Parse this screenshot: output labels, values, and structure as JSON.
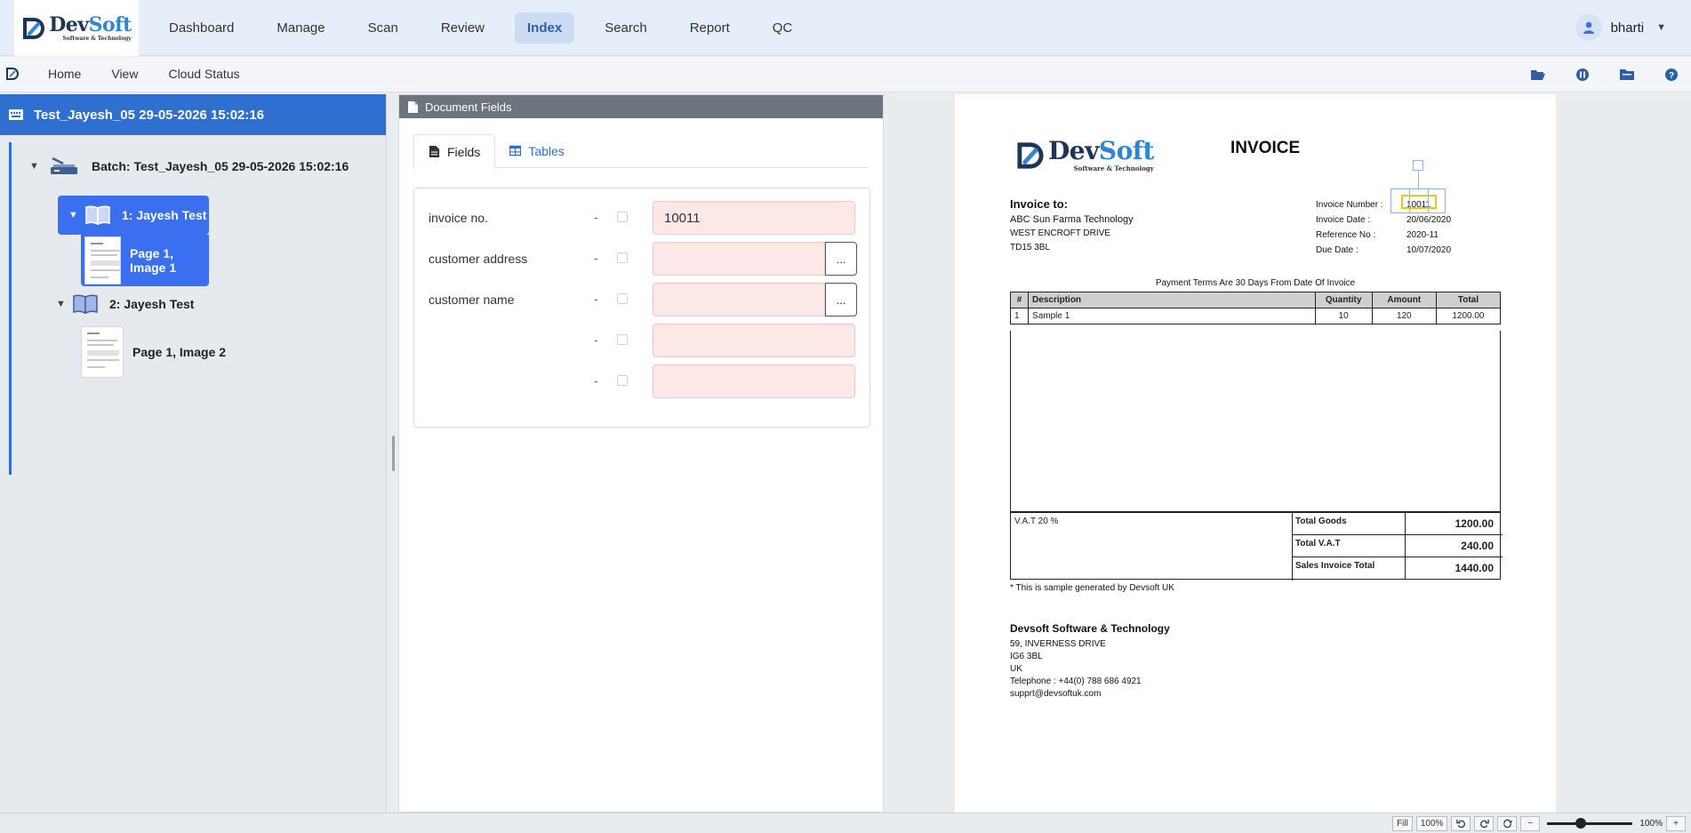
{
  "app": {
    "logo_word_1": "Dev",
    "logo_word_2": "Soft",
    "logo_tagline": "Software & Technology",
    "brand_color": "#2f6fcf"
  },
  "nav": {
    "items": [
      "Dashboard",
      "Manage",
      "Scan",
      "Review",
      "Index",
      "Search",
      "Report",
      "QC"
    ],
    "active": "Index"
  },
  "user": {
    "name": "bharti"
  },
  "subnav": {
    "items": [
      "Home",
      "View",
      "Cloud Status"
    ],
    "tools": [
      "folder-open-icon",
      "pause-circle-icon",
      "folder-icon",
      "help-icon"
    ]
  },
  "tree": {
    "root": "Test_Jayesh_05 29-05-2026 15:02:16",
    "batch": "Batch: Test_Jayesh_05 29-05-2026 15:02:16",
    "docs": [
      {
        "label": "1: Jayesh Test",
        "page": "Page 1, Image 1",
        "selected": true
      },
      {
        "label": "2: Jayesh Test",
        "page": "Page 1, Image 2",
        "selected": false
      }
    ]
  },
  "panel": {
    "title": "Document Fields",
    "tabs": [
      "Fields",
      "Tables"
    ],
    "fields": [
      {
        "label": "invoice no.",
        "dash": "-",
        "value": "10011",
        "has_picker": false
      },
      {
        "label": "customer address",
        "dash": "-",
        "value": "",
        "has_picker": true
      },
      {
        "label": "customer name",
        "dash": "-",
        "value": "",
        "has_picker": true
      },
      {
        "label": "",
        "dash": "-",
        "value": "",
        "has_picker": false
      },
      {
        "label": "",
        "dash": "-",
        "value": "",
        "has_picker": false
      }
    ],
    "picker_label": "..."
  },
  "invoice": {
    "title": "INVOICE",
    "logo_word_1": "Dev",
    "logo_word_2": "Soft",
    "logo_tagline": "Software & Technology",
    "bill_to_title": "Invoice to:",
    "bill_to": [
      "ABC Sun Farma Technology",
      "WEST ENCROFT DRIVE",
      "TD15 3BL"
    ],
    "meta": [
      {
        "k": "Invoice Number :",
        "v": "10011"
      },
      {
        "k": "Invoice Date :",
        "v": "20/06/2020"
      },
      {
        "k": "Reference No :",
        "v": "2020-11"
      },
      {
        "k": "Due Date :",
        "v": "10/07/2020"
      }
    ],
    "terms": "Payment Terms Are 30 Days From Date Of Invoice",
    "columns": [
      "#",
      "Description",
      "Quantity",
      "Amount",
      "Total"
    ],
    "rows": [
      {
        "n": "1",
        "desc": "Sample 1",
        "qty": "10",
        "amount": "120",
        "total": "1200.00"
      }
    ],
    "vat_label": "V.A.T 20 %",
    "totals": [
      {
        "k": "Total Goods",
        "v": "1200.00"
      },
      {
        "k": "Total V.A.T",
        "v": "240.00"
      },
      {
        "k": "Sales Invoice Total",
        "v": "1440.00"
      }
    ],
    "note": "* This is sample generated by Devsoft UK",
    "company_name": "Devsoft Software & Technology",
    "company_lines": [
      "59, INVERNESS DRIVE",
      "IG6 3BL",
      "UK",
      "Telephone : +44(0) 788 686 4921",
      "supprt@devsoftuk.com"
    ]
  },
  "statusbar": {
    "fill": "Fill",
    "zoom_fixed": "100%",
    "zoom": "100%",
    "minus": "−",
    "plus": "+",
    "zoom_level": 1.0
  }
}
